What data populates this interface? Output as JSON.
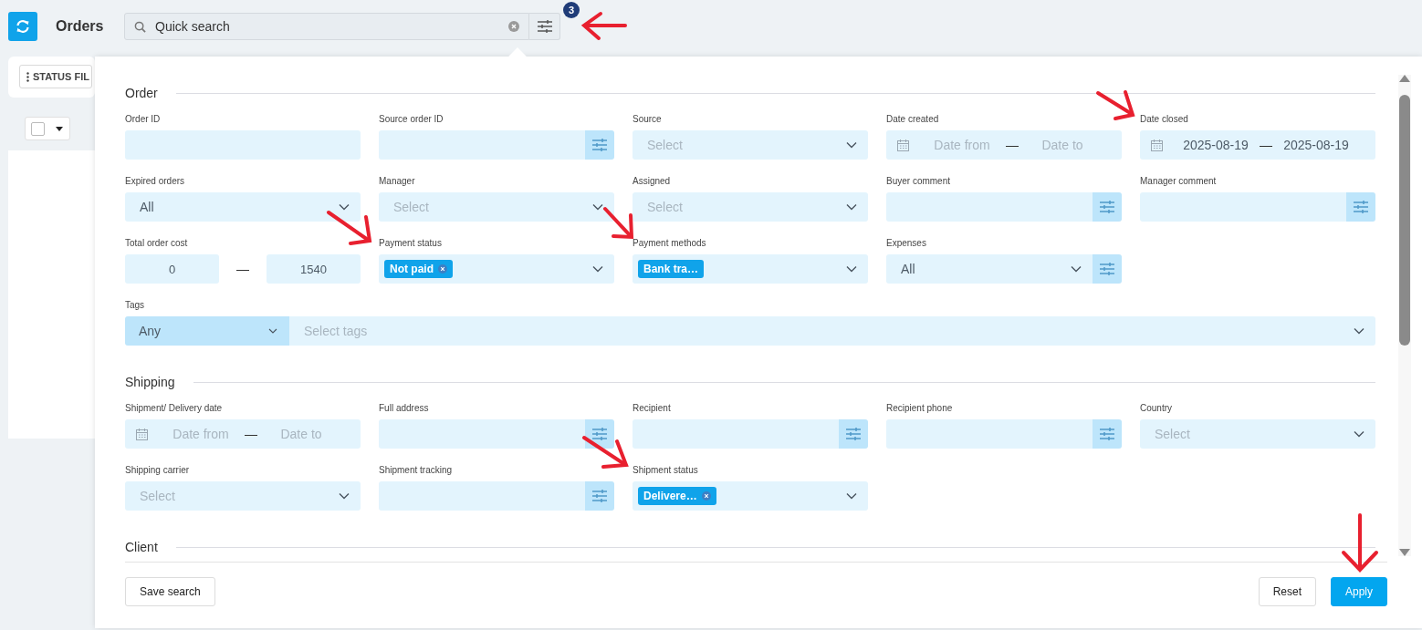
{
  "header": {
    "title": "Orders",
    "search": {
      "placeholder": "Quick search"
    },
    "filter_badge": "3"
  },
  "toolbar": {
    "status_filter_button": "STATUS FIL",
    "select_all": {
      "checked": false
    }
  },
  "filter_panel": {
    "sections": [
      {
        "title": "Order",
        "fields": [
          {
            "label": "Order ID",
            "kind": "text"
          },
          {
            "label": "Source order ID",
            "kind": "text-filter"
          },
          {
            "label": "Source",
            "kind": "select",
            "placeholder": "Select"
          },
          {
            "label": "Date created",
            "kind": "daterange",
            "from": {
              "placeholder": "Date from"
            },
            "separator": "—",
            "to": {
              "placeholder": "Date to"
            }
          },
          {
            "label": "Date closed",
            "kind": "daterange",
            "from": {
              "value": "2025-08-19"
            },
            "separator": "—",
            "to": {
              "value": "2025-08-19"
            }
          },
          {
            "label": "Expired orders",
            "kind": "select",
            "value": "All"
          },
          {
            "label": "Manager",
            "kind": "select",
            "placeholder": "Select"
          },
          {
            "label": "Assigned",
            "kind": "select",
            "placeholder": "Select"
          },
          {
            "label": "Buyer comment",
            "kind": "text-filter"
          },
          {
            "label": "Manager comment",
            "kind": "text-filter"
          },
          {
            "label": "Total order cost",
            "kind": "range",
            "from": {
              "value": "0"
            },
            "separator": "—",
            "to": {
              "value": "1540"
            }
          },
          {
            "label": "Payment status",
            "kind": "chips",
            "chips": [
              {
                "label": "Not paid",
                "removable": true
              }
            ]
          },
          {
            "label": "Payment methods",
            "kind": "chips",
            "chips": [
              {
                "label": "Bank tra…",
                "removable": false
              }
            ]
          },
          {
            "label": "Expenses",
            "kind": "select-filter",
            "value": "All"
          },
          {
            "label": "Tags",
            "kind": "tags",
            "mode": "Any",
            "placeholder": "Select tags"
          }
        ]
      },
      {
        "title": "Shipping",
        "fields": [
          {
            "label": "Shipment/ Delivery date",
            "kind": "daterange",
            "from": {
              "placeholder": "Date from"
            },
            "separator": "—",
            "to": {
              "placeholder": "Date to"
            }
          },
          {
            "label": "Full address",
            "kind": "text-filter"
          },
          {
            "label": "Recipient",
            "kind": "text-filter"
          },
          {
            "label": "Recipient phone",
            "kind": "text-filter"
          },
          {
            "label": "Country",
            "kind": "select",
            "placeholder": "Select"
          },
          {
            "label": "Shipping carrier",
            "kind": "select",
            "placeholder": "Select"
          },
          {
            "label": "Shipment tracking",
            "kind": "text-filter"
          },
          {
            "label": "Shipment status",
            "kind": "chips",
            "chips": [
              {
                "label": "Delivere…",
                "removable": true
              }
            ]
          }
        ]
      },
      {
        "title": "Client"
      }
    ],
    "footer": {
      "save_button": "Save search",
      "reset_button": "Reset",
      "apply_button": "Apply"
    }
  }
}
